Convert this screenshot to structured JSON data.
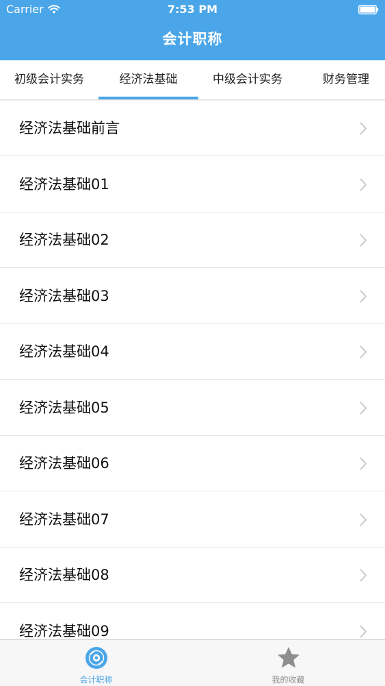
{
  "status_bar": {
    "carrier": "Carrier",
    "time": "7:53 PM"
  },
  "nav": {
    "title": "会计职称"
  },
  "tabs": [
    {
      "label": "初级会计实务",
      "selected": false
    },
    {
      "label": "经济法基础",
      "selected": true
    },
    {
      "label": "中级会计实务",
      "selected": false
    },
    {
      "label": "财务管理",
      "selected": false
    }
  ],
  "list": {
    "items": [
      {
        "label": "经济法基础前言"
      },
      {
        "label": "经济法基础01"
      },
      {
        "label": "经济法基础02"
      },
      {
        "label": "经济法基础03"
      },
      {
        "label": "经济法基础04"
      },
      {
        "label": "经济法基础05"
      },
      {
        "label": "经济法基础06"
      },
      {
        "label": "经济法基础07"
      },
      {
        "label": "经济法基础08"
      },
      {
        "label": "经济法基础09"
      }
    ]
  },
  "tabbar": {
    "items": [
      {
        "label": "会计职称",
        "icon": "disc-icon",
        "selected": true
      },
      {
        "label": "我的收藏",
        "icon": "star-icon",
        "selected": false
      }
    ]
  },
  "colors": {
    "accent": "#4aa6e8",
    "inactive": "#8e8e8e"
  }
}
